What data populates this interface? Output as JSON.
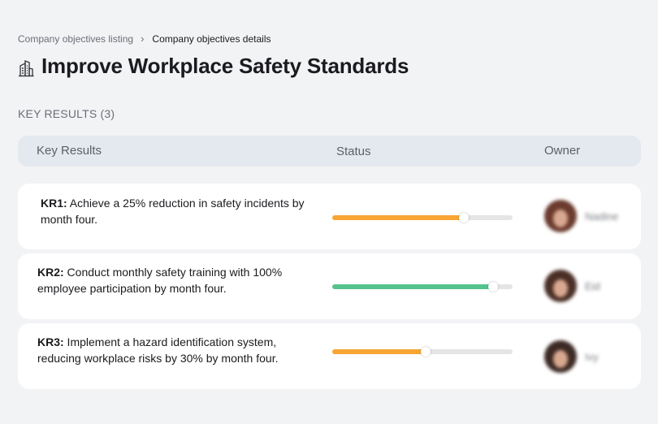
{
  "breadcrumb": {
    "parent": "Company objectives listing",
    "separator": "›",
    "current": "Company objectives details"
  },
  "page": {
    "title": "Improve Workplace Safety Standards",
    "title_icon": "building-icon"
  },
  "section": {
    "label": "KEY RESULTS (3)"
  },
  "table": {
    "columns": [
      "Key Results",
      "Status",
      "Owner"
    ]
  },
  "colors": {
    "progress_orange": "#f7a533",
    "progress_green": "#55c38d",
    "track": "#e5e5e5"
  },
  "key_results": [
    {
      "code": "KR1:",
      "text": " Achieve a 25% reduction in safety incidents by month four.",
      "progress": 0.73,
      "color": "#f7a533",
      "owner": "Nadine"
    },
    {
      "code": "KR2:",
      "text": " Conduct monthly safety training with 100% employee participation by month four.",
      "progress": 0.89,
      "color": "#55c38d",
      "owner": "Eid"
    },
    {
      "code": "KR3:",
      "text": " Implement a hazard identification system, reducing workplace risks by 30% by month four.",
      "progress": 0.52,
      "color": "#f7a533",
      "owner": "Ivy"
    }
  ]
}
